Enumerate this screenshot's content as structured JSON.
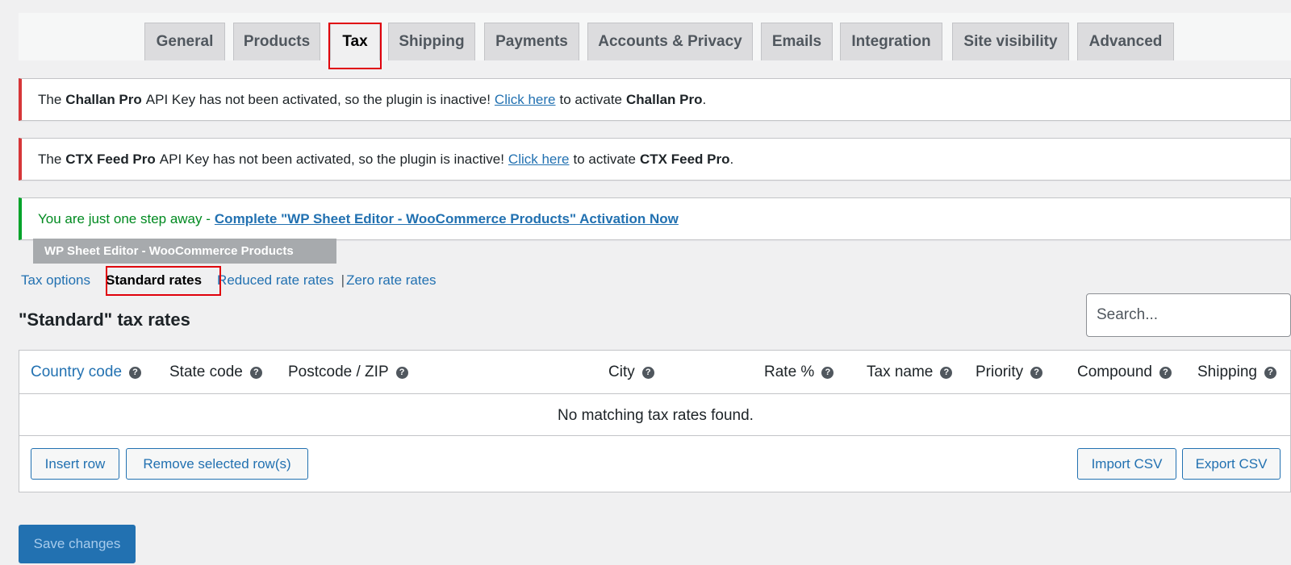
{
  "tabs": [
    {
      "label": "General"
    },
    {
      "label": "Products"
    },
    {
      "label": "Tax"
    },
    {
      "label": "Shipping"
    },
    {
      "label": "Payments"
    },
    {
      "label": "Accounts & Privacy"
    },
    {
      "label": "Emails"
    },
    {
      "label": "Integration"
    },
    {
      "label": "Site visibility"
    },
    {
      "label": "Advanced"
    }
  ],
  "notices": {
    "challan": {
      "pre": "The",
      "name": "Challan Pro",
      "mid": "API Key has not been activated, so the plugin is inactive!",
      "link": "Click here",
      "post": "to activate",
      "name2": "Challan Pro",
      "end": "."
    },
    "ctx": {
      "pre": "The",
      "name": "CTX Feed Pro",
      "mid": "API Key has not been activated, so the plugin is inactive!",
      "link": "Click here",
      "post": "to activate",
      "name2": "CTX Feed Pro",
      "end": "."
    },
    "sheet": {
      "text": "You are just one step away -",
      "link": "Complete \"WP Sheet Editor - WooCommerce Products\" Activation Now"
    }
  },
  "plugin_badge": "WP Sheet Editor - WooCommerce Products",
  "subnav": {
    "tax_options": "Tax options",
    "standard": "Standard rates",
    "reduced": "Reduced rate rates",
    "separator": "|",
    "zero": "Zero rate rates"
  },
  "heading": "\"Standard\" tax rates",
  "search": {
    "placeholder": "Search..."
  },
  "table": {
    "columns": {
      "country": "Country code",
      "state": "State code",
      "postcode": "Postcode / ZIP",
      "city": "City",
      "rate": "Rate %",
      "taxname": "Tax name",
      "priority": "Priority",
      "compound": "Compound",
      "shipping": "Shipping"
    },
    "empty": "No matching tax rates found.",
    "insert_row": "Insert row",
    "remove_rows": "Remove selected row(s)",
    "import_csv": "Import CSV",
    "export_csv": "Export CSV"
  },
  "help_glyph": "?",
  "save_label": "Save changes",
  "colors": {
    "accent": "#2271b1",
    "error": "#d63638",
    "success": "#00a32a",
    "highlight": "#e0000b"
  }
}
